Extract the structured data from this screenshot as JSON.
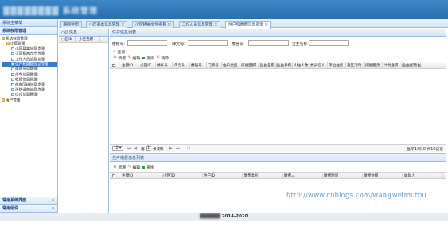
{
  "banner": {
    "title": "▓▓▓▓▓▓▓▓ 系统管理"
  },
  "west": {
    "header": "系统主菜单",
    "section_title": "系统权限管理",
    "tree": [
      {
        "label": "系统权限管理",
        "level": 0,
        "icon": "folder"
      },
      {
        "label": "小区管理",
        "level": 1,
        "icon": "folder"
      },
      {
        "label": "小区基本信息管理",
        "level": 2,
        "icon": "page"
      },
      {
        "label": "小区相关文件管理",
        "level": 2,
        "icon": "page"
      },
      {
        "label": "工作人员信息管理",
        "level": 2,
        "icon": "page"
      },
      {
        "label": "住户和缴费信息管理",
        "level": 2,
        "icon": "page",
        "selected": true
      },
      {
        "label": "缴费信息管理",
        "level": 2,
        "icon": "page"
      },
      {
        "label": "停车信息管理",
        "level": 2,
        "icon": "page"
      },
      {
        "label": "收费信息管理",
        "level": 2,
        "icon": "page"
      },
      {
        "label": "停车区域信息管理",
        "level": 2,
        "icon": "page"
      },
      {
        "label": "消防设备信息管理",
        "level": 2,
        "icon": "page"
      },
      {
        "label": "绿化信息管理",
        "level": 2,
        "icon": "page"
      },
      {
        "label": "用户管理",
        "level": 0,
        "icon": "folder"
      }
    ],
    "bottom_sections": [
      "常用系统界面",
      "常用组件"
    ]
  },
  "tabs": [
    {
      "label": "系统主页",
      "closable": false
    },
    {
      "label": "小区基本信息管理",
      "closable": true
    },
    {
      "label": "小区相关文件查看",
      "closable": true
    },
    {
      "label": "工作人员信息管理",
      "closable": true
    },
    {
      "label": "住户和缴费信息管理",
      "closable": true,
      "active": true
    }
  ],
  "community_panel": {
    "title": "小区信息",
    "columns": [
      "小区ID",
      "小区名称"
    ]
  },
  "resident_panel": {
    "title": "住户信息列表",
    "search": {
      "building_label": "楼栋号:",
      "unit_label": "单元号:",
      "floor_label": "楼层号:",
      "community_label": "业主名称:",
      "query_label": "查询"
    },
    "toolbar": {
      "add": "新增",
      "edit": "编辑",
      "delete": "删除",
      "clear": "清除"
    },
    "columns": [
      "主键ID",
      "小区ID",
      "楼栋号",
      "单元号",
      "楼层号",
      "门牌号",
      "住户类型",
      "房屋面积",
      "业主名称",
      "业主手机",
      "人住人数",
      "党员信人",
      "单位住房",
      "社区活动",
      "房屋租赁",
      "计划生育",
      "业主留意生"
    ],
    "pager": {
      "page_size": "10",
      "page_label": "第",
      "page_value": "1",
      "page_total": "共1页",
      "summary": "显示1到10,共10记录"
    }
  },
  "fee_panel": {
    "title": "住户缴费信息列表",
    "toolbar": {
      "add": "新增",
      "edit": "编辑",
      "delete": "删除"
    },
    "columns": [
      "主键ID",
      "小区ID",
      "住户ID",
      "缴费类别",
      "缴费人",
      "缴费时间",
      "缴费金额",
      "收款人"
    ]
  },
  "watermark": "http://www.cnblogs.com/wangweimutou",
  "footer": {
    "copyright_hidden": "▓▓▓▓▓▓",
    "years": "2014-2020"
  },
  "colors": {
    "accent": "#2a6fae",
    "selected": "#3979c6",
    "link": "#6b9bd6"
  }
}
